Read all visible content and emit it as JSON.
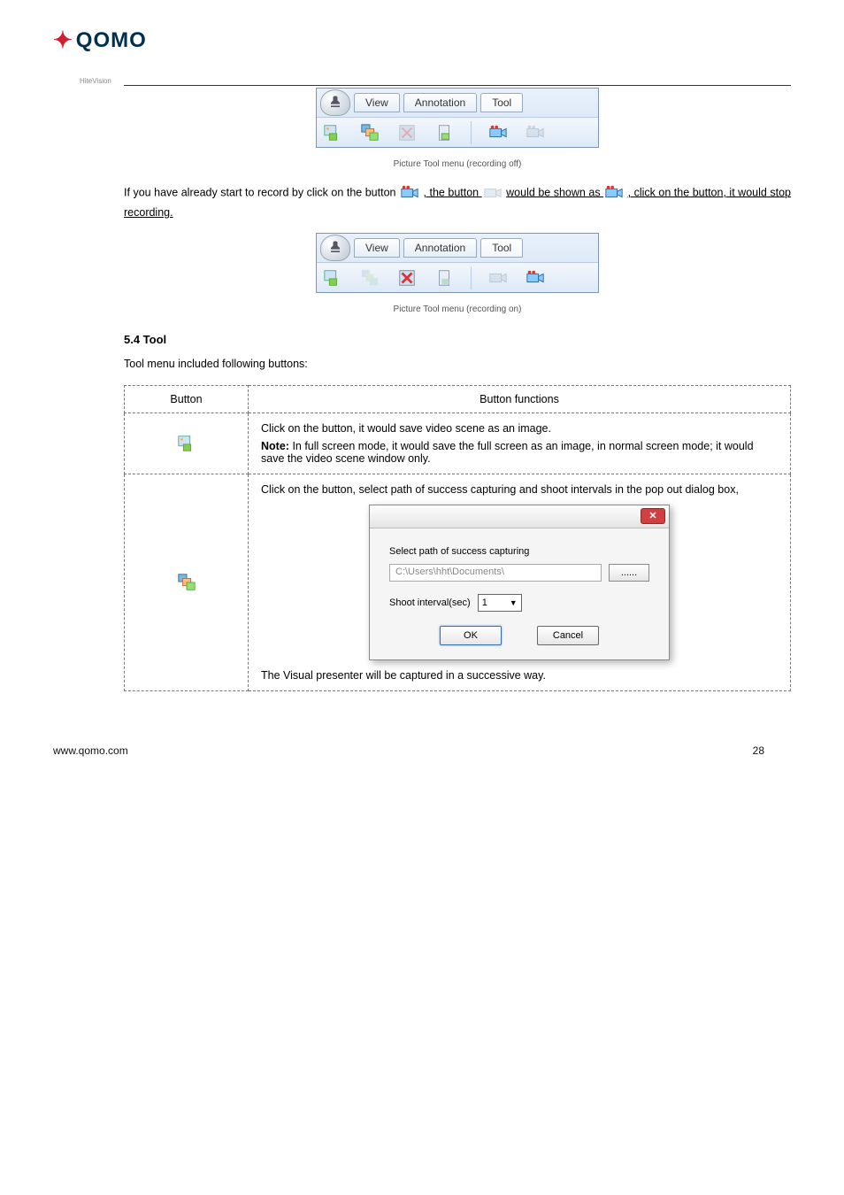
{
  "logo": {
    "brand": "QOMO",
    "sub": "HiteVision"
  },
  "section_title": "5.4 Tool",
  "toolbar": {
    "tabs": {
      "view": "View",
      "annotation": "Annotation",
      "tool": "Tool"
    }
  },
  "para1_prefix": "If you have already start to record by click on the button ",
  "para1_after_icon": ", the button ",
  "para1_mid": " would be shown as ",
  "para1_tail": ", click on the button, it would stop recording.",
  "captions": {
    "pic_off": "Picture Tool menu (recording off)",
    "pic_on": "Picture Tool menu (recording on)"
  },
  "tool_intro": "Tool menu included following buttons:",
  "table": {
    "h1": "Button",
    "h2": "Button functions",
    "r1_desc": "Click on the button, it would save video scene as an image.",
    "r1_note_label": "Note:",
    "r1_note": " In full screen mode, it would save the full screen as an image, in normal screen mode; it would save the video scene window only.",
    "r2_pre": "Click on the button, select path of success capturing and shoot intervals in the pop out dialog box,",
    "r2_post": "The Visual presenter will be captured in a successive way."
  },
  "dialog": {
    "label_path": "Select path of success capturing",
    "path_value": "C:\\Users\\hht\\Documents\\",
    "browse": "......",
    "label_interval": "Shoot interval(sec)",
    "interval_value": "1",
    "ok": "OK",
    "cancel": "Cancel"
  },
  "footer": {
    "left": "www.qomo.com",
    "right": "28"
  }
}
